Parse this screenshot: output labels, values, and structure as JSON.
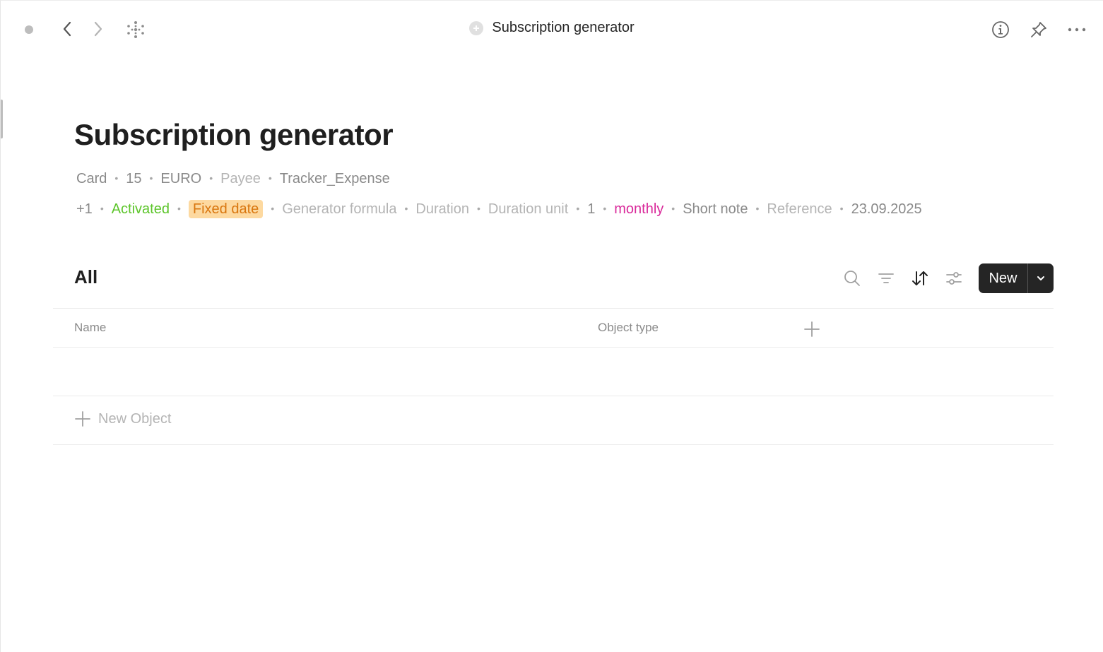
{
  "window": {
    "title": "Subscription generator"
  },
  "object": {
    "title": "Subscription generator",
    "relations": [
      {
        "text": "Card",
        "style": "normal"
      },
      {
        "text": "15",
        "style": "normal"
      },
      {
        "text": "EURO",
        "style": "normal"
      },
      {
        "text": "Payee",
        "style": "muted"
      },
      {
        "text": "Tracker_Expense",
        "style": "normal"
      },
      {
        "text": "+1",
        "style": "normal"
      },
      {
        "text": "Activated",
        "style": "green"
      },
      {
        "text": "Fixed date",
        "style": "tag"
      },
      {
        "text": "Generator formula",
        "style": "muted"
      },
      {
        "text": "Duration",
        "style": "muted"
      },
      {
        "text": "Duration unit",
        "style": "muted"
      },
      {
        "text": "1",
        "style": "normal"
      },
      {
        "text": "monthly",
        "style": "pink"
      },
      {
        "text": "Short note",
        "style": "normal"
      },
      {
        "text": "Reference",
        "style": "muted"
      },
      {
        "text": "23.09.2025",
        "style": "normal"
      }
    ],
    "separator": "•"
  },
  "view": {
    "title": "All",
    "new_label": "New",
    "columns": [
      "Name",
      "Object type"
    ],
    "new_object_label": "New Object"
  },
  "colors": {
    "green": "#5cc52a",
    "pink": "#d9289a",
    "tag_bg": "#fdd9a0",
    "tag_fg": "#d9760e",
    "button_bg": "#252525"
  },
  "icons": {
    "nav": [
      "status-dot-icon",
      "back-arrow-icon",
      "forward-arrow-icon",
      "graph-icon"
    ],
    "right": [
      "info-icon",
      "pin-icon",
      "more-icon"
    ],
    "tools": [
      "search-icon",
      "filter-icon",
      "sort-icon",
      "settings-icon"
    ]
  }
}
